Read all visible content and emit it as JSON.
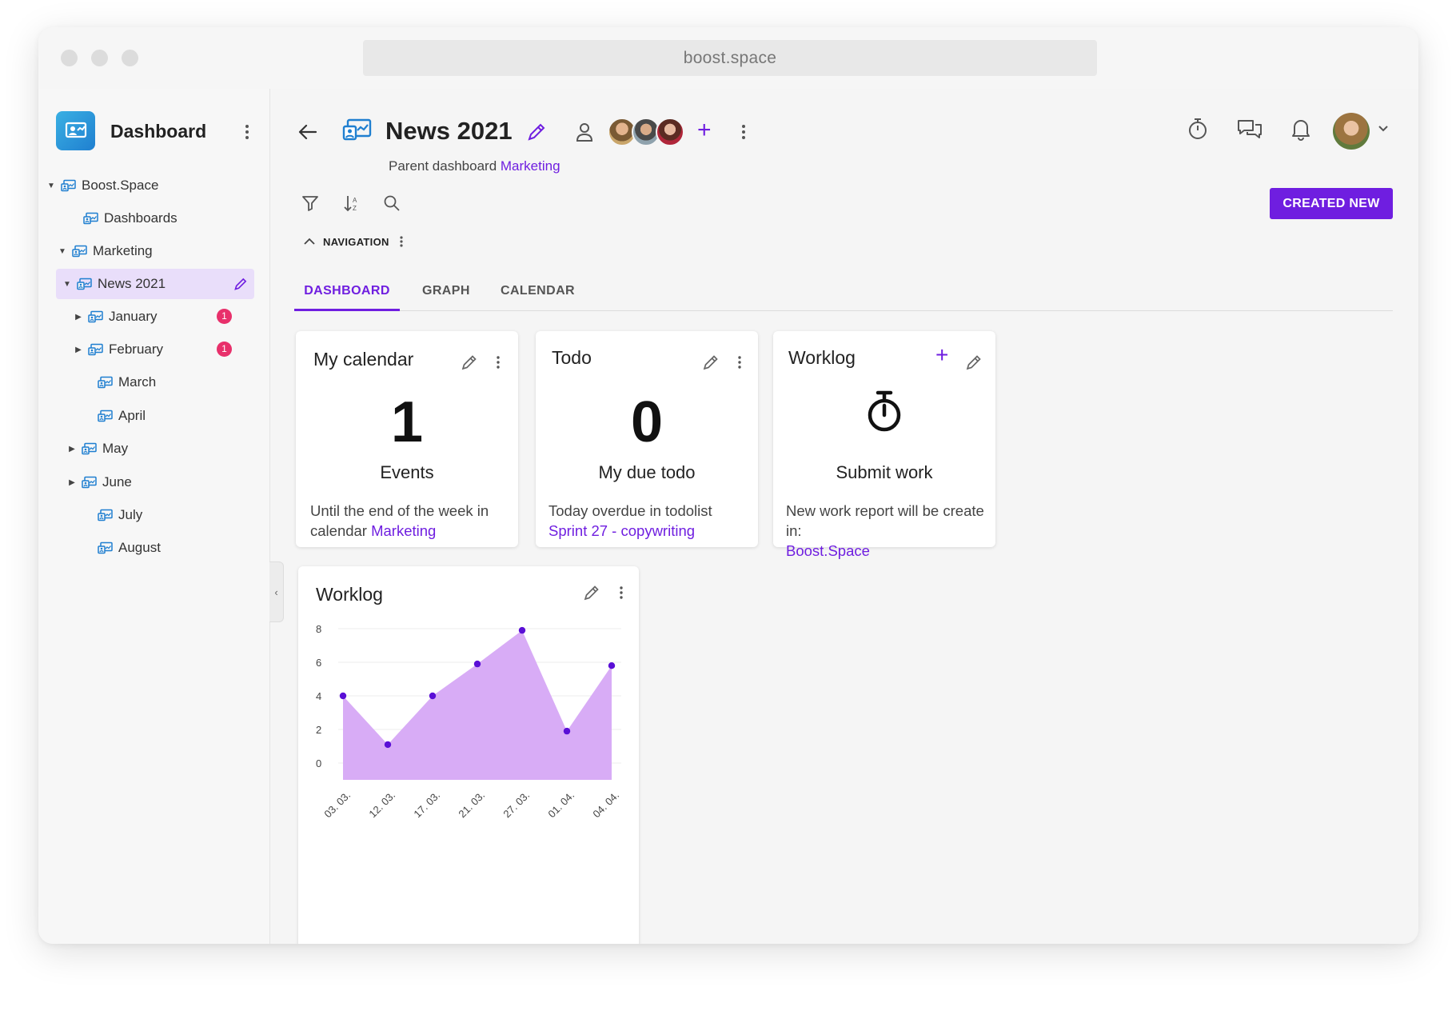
{
  "browser": {
    "url": "boost.space"
  },
  "sidebar": {
    "title": "Dashboard",
    "tree": [
      {
        "label": "Boost.Space"
      },
      {
        "label": "Dashboards"
      },
      {
        "label": "Marketing"
      },
      {
        "label": "News 2021"
      },
      {
        "label": "January",
        "badge": "1"
      },
      {
        "label": "February",
        "badge": "1"
      },
      {
        "label": "March"
      },
      {
        "label": "April"
      },
      {
        "label": "May"
      },
      {
        "label": "June"
      },
      {
        "label": "July"
      },
      {
        "label": "August"
      }
    ]
  },
  "header": {
    "title": "News 2021",
    "parent_prefix": "Parent dashboard",
    "parent_link": "Marketing",
    "add_member": "+",
    "created_new": "CREATED NEW"
  },
  "navigation": {
    "label": "NAVIGATION"
  },
  "tabs": [
    {
      "label": "DASHBOARD",
      "active": true
    },
    {
      "label": "GRAPH"
    },
    {
      "label": "CALENDAR"
    }
  ],
  "cards": {
    "calendar": {
      "title": "My calendar",
      "value": "1",
      "subtitle": "Events",
      "desc": "Until the end of the week in calendar",
      "link": "Marketing"
    },
    "todo": {
      "title": "Todo",
      "value": "0",
      "subtitle": "My due todo",
      "desc": "Today overdue in todolist",
      "link": "Sprint 27 - copywriting"
    },
    "worklog": {
      "title": "Worklog",
      "add": "+",
      "subtitle": "Submit work",
      "desc": "New work report will be create in:",
      "link": "Boost.Space"
    },
    "worklog_chart": {
      "title": "Worklog"
    }
  },
  "colors": {
    "accent": "#6f1ee0",
    "badge": "#e8306b",
    "chart_fill": "#d6a8f5",
    "chart_point": "#5a0fd6"
  },
  "chart_data": {
    "type": "area",
    "title": "Worklog",
    "categories": [
      "03. 03.",
      "12. 03.",
      "17. 03.",
      "21. 03.",
      "27. 03.",
      "01. 04.",
      "04. 04."
    ],
    "values": [
      4,
      1.1,
      4,
      5.9,
      7.9,
      1.9,
      5.8
    ],
    "yticks": [
      0,
      2,
      4,
      6,
      8
    ],
    "ylim": [
      -1,
      8
    ],
    "grid": true,
    "xlabel": "",
    "ylabel": ""
  }
}
